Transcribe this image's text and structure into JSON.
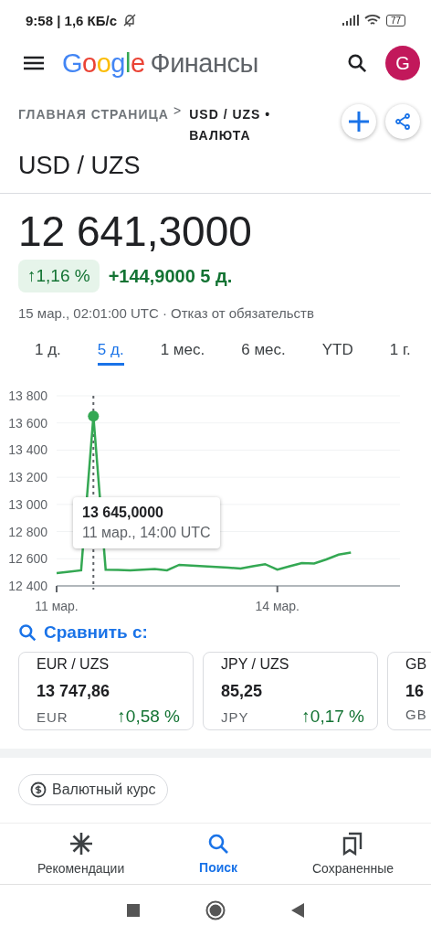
{
  "status_bar": {
    "time": "9:58 | 1,6 КБ/с",
    "battery": "77"
  },
  "app_bar": {
    "logo": "Google",
    "title": "Финансы",
    "avatar": "G"
  },
  "breadcrumb": {
    "home": "ГЛАВНАЯ СТРАНИЦА",
    "separator": ">",
    "current": "USD / UZS • ВАЛЮТА"
  },
  "heading": "USD / UZS",
  "quote": {
    "price": "12 641,3000",
    "change_percent": "↑1,16 %",
    "change": "+144,9000 5 д.",
    "timestamp": "15 мар., 02:01:00 UTC · ",
    "disclaimer": "Отказ от обязательств"
  },
  "ranges": [
    {
      "label": "1 д.",
      "selected": false
    },
    {
      "label": "5 д.",
      "selected": true
    },
    {
      "label": "1 мес.",
      "selected": false
    },
    {
      "label": "6 мес.",
      "selected": false
    },
    {
      "label": "YTD",
      "selected": false
    },
    {
      "label": "1 г.",
      "selected": false
    }
  ],
  "chart_data": {
    "type": "line",
    "categories": [
      "11 мар.",
      null,
      null,
      null,
      null,
      null,
      null,
      null,
      null,
      null,
      null,
      null,
      null,
      null,
      null,
      null,
      null,
      null,
      "14 мар.",
      null,
      null,
      null,
      null,
      null,
      null,
      null,
      null,
      null,
      null
    ],
    "series": [
      {
        "color": "#34a853",
        "values": [
          12495,
          12505,
          12515,
          13650,
          12520,
          12518,
          12515,
          12520,
          12525,
          12515,
          12555,
          12550,
          12545,
          12540,
          12535,
          12528,
          12545,
          12560,
          12520,
          12545,
          12568,
          12565,
          12595,
          12630,
          12645,
          null,
          null,
          null,
          null
        ]
      }
    ],
    "ylim": [
      12400,
      13800
    ],
    "grid": true,
    "yticks": [
      {
        "value": 12400,
        "label": "12 400"
      },
      {
        "value": 12600,
        "label": "12 600"
      },
      {
        "value": 12800,
        "label": "12 800"
      },
      {
        "value": 13000,
        "label": "13 000"
      },
      {
        "value": 13200,
        "label": "13 200"
      },
      {
        "value": 13400,
        "label": "13 400"
      },
      {
        "value": 13600,
        "label": "13 600"
      },
      {
        "value": 13800,
        "label": "13 800"
      }
    ]
  },
  "tooltip": {
    "value": "13 645,0000",
    "date": "11 мар., 14:00 UTC"
  },
  "compare": {
    "label": "Сравнить с:",
    "cards": [
      {
        "pair": "EUR / UZS",
        "price": "13 747,86",
        "currency": "EUR",
        "change": "↑0,58 %"
      },
      {
        "pair": "JPY / UZS",
        "price": "85,25",
        "currency": "JPY",
        "change": "↑0,17 %"
      },
      {
        "pair": "GB",
        "price": "16",
        "currency": "GB"
      }
    ]
  },
  "chip": "Валютный курс",
  "nav": [
    {
      "label": "Рекомендации",
      "kind": "star",
      "selected": false
    },
    {
      "label": "Поиск",
      "kind": "search",
      "selected": true
    },
    {
      "label": "Сохраненные",
      "kind": "saved",
      "selected": false
    }
  ]
}
